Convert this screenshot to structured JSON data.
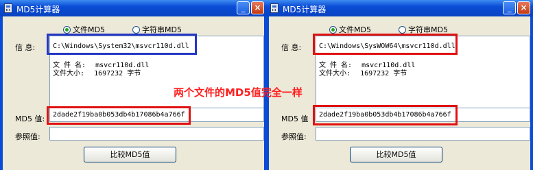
{
  "windows": [
    {
      "title": "MD5计算器",
      "radio_file": "文件MD5",
      "radio_string": "字符串MD5",
      "info_label": "信 息:",
      "path": "C:\\Windows\\System32\\msvcr110d.dll",
      "file_name_label": "文 件 名:",
      "file_name": "msvcr110d.dll",
      "file_size_label": "文件大小:",
      "file_size": "1697232 字节",
      "md5_label": "MD5 值:",
      "md5_value": "2dade2f19ba0b053db4b17086b4a766f",
      "ref_label": "参照值:",
      "ref_value": "",
      "compare_button": "比较MD5值",
      "min_glyph": "_",
      "close_glyph": "×"
    },
    {
      "title": "MD5计算器",
      "radio_file": "文件MD5",
      "radio_string": "字符串MD5",
      "info_label": "信 息:",
      "path": "C:\\Windows\\SysWOW64\\msvcr110d.dll",
      "file_name_label": "文 件 名:",
      "file_name": "msvcr110d.dll",
      "file_size_label": "文件大小:",
      "file_size": "1697232 字节",
      "md5_label": "MD5 值",
      "md5_value": "2dade2f19ba0b053db4b17086b4a766f",
      "ref_label": "参照值:",
      "ref_value": "",
      "compare_button": "比较MD5值",
      "min_glyph": "_",
      "close_glyph": "×"
    }
  ],
  "annotation": "两个文件的MD5值完全一样",
  "colors": {
    "highlight_red": "#e01010",
    "highlight_blue": "#2336c4",
    "annotation": "#ff2020"
  },
  "icons": {
    "app": "calculator-icon",
    "minimize": "minimize-icon",
    "close": "close-icon"
  }
}
